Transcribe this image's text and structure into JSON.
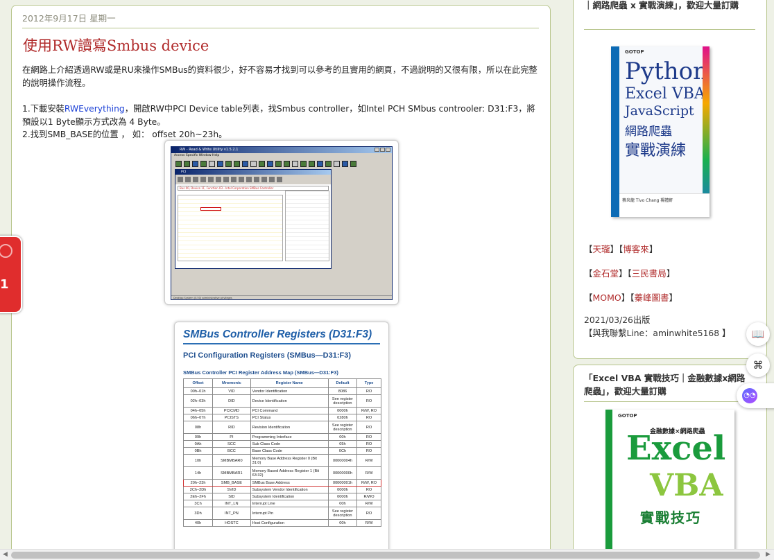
{
  "post": {
    "date": "2012年9月17日 星期一",
    "title": "使用RW讀寫Smbus device",
    "intro": "在網路上介紹透過RW或是RU來操作SMBus的資料很少，好不容易才找到可以參考的且實用的網頁，不過說明的又很有限，所以在此完整的說明操作流程。",
    "step1_pre": "1.下載安裝",
    "step1_link": "RWEverything",
    "step1_post": "，開啟RW中PCI Device table列表，找Smbus controller，如Intel PCH SMbus controoler: D31:F3，將預設以1 Byte顯示方式改為 4 Byte。",
    "step2": "2.找到SMB_BASE的位置 ， 如： offset 20h~23h。"
  },
  "rw_window": {
    "title": "RW - Read & Write Utility v1.5.2.1",
    "menu": "Access  Specific  Window  Help",
    "pci_title": "PCI",
    "dropdown": "Bus 00, Device 1F, Function 03 - Intel Corporation SMBus Controller",
    "status": "Desktop System (0.50) administrative privileges"
  },
  "register_doc": {
    "heading": "SMBus Controller Registers (D31:F3)",
    "subheading": "PCI Configuration Registers (SMBus—D31:F3)",
    "caption": "SMBus Controller PCI Register Address Map (SMBus—D31:F3)",
    "columns": [
      "Offset",
      "Mnemonic",
      "Register Name",
      "Default",
      "Type"
    ],
    "rows": [
      [
        "00h–01h",
        "VID",
        "Vendor Identification",
        "8086",
        "RO"
      ],
      [
        "02h–03h",
        "DID",
        "Device Identification",
        "See register description",
        "RO"
      ],
      [
        "04h–05h",
        "PCICMD",
        "PCI Command",
        "0000h",
        "R/W, RO"
      ],
      [
        "06h–07h",
        "PCISTS",
        "PCI Status",
        "0280h",
        "RO"
      ],
      [
        "08h",
        "RID",
        "Revision Identification",
        "See register description",
        "RO"
      ],
      [
        "09h",
        "PI",
        "Programming Interface",
        "00h",
        "RO"
      ],
      [
        "0Ah",
        "SCC",
        "Sub Class Code",
        "05h",
        "RO"
      ],
      [
        "0Bh",
        "BCC",
        "Base Class Code",
        "0Ch",
        "RO"
      ],
      [
        "10h",
        "SMBMBAR0",
        "Memory Base Address Register 0 (Bit 31:0)",
        "00000004h",
        "R/W"
      ],
      [
        "14h",
        "SMBMBAR1",
        "Memory Based Address Register 1 (Bit 63:32)",
        "00000000h",
        "R/W"
      ],
      [
        "20h–23h",
        "SMB_BASE",
        "SMBus Base Address",
        "00000001h",
        "R/W, RO"
      ],
      [
        "2Ch–2Dh",
        "SVID",
        "Subsystem Vendor Identification",
        "0000h",
        "RO"
      ],
      [
        "2Eh–2Fh",
        "SID",
        "Subsystem Identification",
        "0000h",
        "R/WO"
      ],
      [
        "3Ch",
        "INT_LN",
        "Interrupt Line",
        "00h",
        "R/W"
      ],
      [
        "3Dh",
        "INT_PN",
        "Interrupt Pin",
        "See register description",
        "RO"
      ],
      [
        "40h",
        "HOSTC",
        "Host Configuration",
        "00h",
        "R/W"
      ]
    ]
  },
  "sidebar": {
    "box1_head": "｜網路爬蟲 x 實戰演練」，歡迎大量訂購",
    "book1": {
      "publisher": "GOTOP",
      "l1": "Python",
      "l2": "Excel VBA",
      "l3": "JavaScript",
      "l4": "網路爬蟲",
      "l5": "實戰演練",
      "authors": "蔡炎龍  Tivo Chang  楊禮軒"
    },
    "links": {
      "a": "天瓏",
      "b": "博客來",
      "c": "金石堂",
      "d": "三民書局",
      "e": "MOMO",
      "f": "蓁峰圖書"
    },
    "pub_date": "2021/03/26出版",
    "contact": "【與我聯繫Line：aminwhite5168 】",
    "box2_head": "「Excel VBA 實戰技巧｜金融數據x網路爬蟲」，歡迎大量訂購",
    "book2": {
      "publisher": "GOTOP",
      "sub": "金融數據×網路爬蟲",
      "l1": "Excel",
      "l2": "VBA",
      "l3": "實戰技巧"
    }
  },
  "widgets": {
    "float_tab": "1",
    "fab_book": "📖",
    "fab_grid": "⌘",
    "fab_ai": "◔◔"
  },
  "scroll": {
    "left": "◀",
    "right": "▶"
  }
}
